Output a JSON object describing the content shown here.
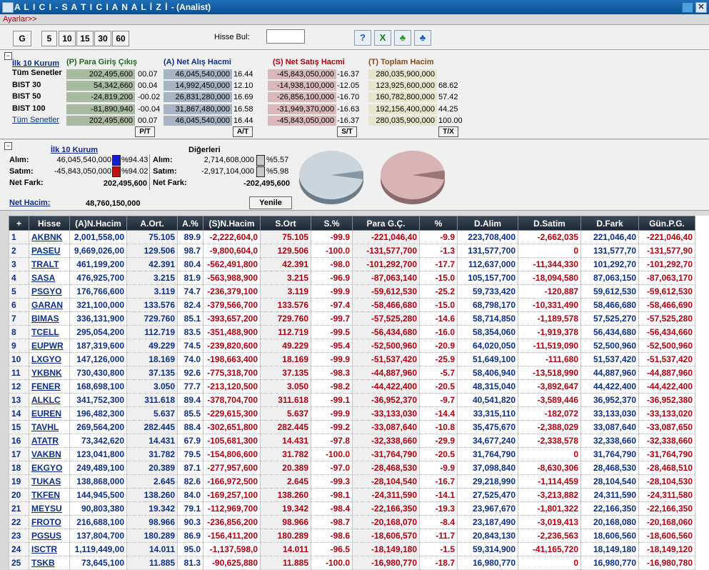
{
  "window": {
    "title": "A L I C I  -  S A T I C I   A N A L İ Z İ",
    "subtitle": "- (Analist)"
  },
  "settings_link": "Ayarlar>>",
  "toolbar": {
    "period_buttons": [
      "G",
      "5",
      "10",
      "15",
      "30",
      "60"
    ],
    "search_label": "Hisse Bul:",
    "search_value": ""
  },
  "summary": {
    "top10_link": "İlk 10 Kurum",
    "col_headers": [
      "(P) Para Giriş Çıkış",
      "(A) Net Alış Hacmi",
      "(S) Net Satış Hacmi",
      "(T) Toplam Hacim"
    ],
    "rows": [
      {
        "label": "Tüm Senetler",
        "p": "202,495,600",
        "pp": "00.07",
        "a": "46,045,540,000",
        "ap": "16.44",
        "s": "-45,843,050,000",
        "sp": "-16.37",
        "t": "280,035,900,000",
        "tp": ""
      },
      {
        "label": "BIST 30",
        "p": "54,342,660",
        "pp": "00.04",
        "a": "14,992,450,000",
        "ap": "12.10",
        "s": "-14,938,100,000",
        "sp": "-12.05",
        "t": "123,925,600,000",
        "tp": "68.62"
      },
      {
        "label": "BIST 50",
        "p": "-24,819,200",
        "pp": "-00.02",
        "a": "26,831,280,000",
        "ap": "16.69",
        "s": "-26,856,100,000",
        "sp": "-16.70",
        "t": "160,782,800,000",
        "tp": "57.42"
      },
      {
        "label": "BIST 100",
        "p": "-81,890,940",
        "pp": "-00.04",
        "a": "31,867,480,000",
        "ap": "16.58",
        "s": "-31,949,370,000",
        "sp": "-16.63",
        "t": "192,156,400,000",
        "tp": "44.25"
      },
      {
        "label": "Tüm Senetler",
        "p": "202,495,600",
        "pp": "00.07",
        "a": "46,045,540,000",
        "ap": "16.44",
        "s": "-45,843,050,000",
        "sp": "-16.37",
        "t": "280,035,900,000",
        "tp": "100.00"
      }
    ],
    "sort_buttons": [
      "P/T",
      "A/T",
      "S/T",
      "T/X"
    ]
  },
  "middle": {
    "top10_link": "İlk 10 Kurum",
    "others_title": "Diğerleri",
    "labels": {
      "alim": "Alım:",
      "satim": "Satım:",
      "net_fark": "Net Fark:",
      "net_hacim": "Net Hacim:"
    },
    "top10": {
      "alim": "46,045,540,000",
      "alim_pct": "%94.43",
      "satim": "-45,843,050,000",
      "satim_pct": "%94.02",
      "net_fark": "202,495,600"
    },
    "others": {
      "alim": "2,714,608,000",
      "alim_pct": "%5.57",
      "satim": "-2,917,104,000",
      "satim_pct": "%5.98",
      "net_fark": "-202,495,600"
    },
    "net_hacim": "48,760,150,000",
    "refresh_button": "Yenile",
    "pie_buy_share": 0.9443,
    "pie_sell_share": 0.9402
  },
  "table": {
    "headers": [
      "+",
      "Hisse",
      "(A)N.Hacim",
      "A.Ort.",
      "A.%",
      "(S)N.Hacim",
      "S.Ort",
      "S.%",
      "Para G.Ç.",
      "%",
      "D.Alim",
      "D.Satim",
      "D.Fark",
      "Gün.P.G."
    ],
    "rows": [
      [
        "1",
        "AKBNK",
        "2,001,558,00",
        "75.105",
        "89.9",
        "-2,222,604,0",
        "75.105",
        "-99.9",
        "-221,046,40",
        "-9.9",
        "223,708,400",
        "-2,662,035",
        "221,046,40",
        "-221,046,40"
      ],
      [
        "2",
        "PASEU",
        "9,669,026,00",
        "129.506",
        "98.7",
        "-9,800,604,0",
        "129.506",
        "-100.0",
        "-131,577,700",
        "-1.3",
        "131,577,700",
        "0",
        "131,577,70",
        "-131,577,90"
      ],
      [
        "3",
        "TRALT",
        "461,199,200",
        "42.391",
        "80.4",
        "-562,491,800",
        "42.391",
        "-98.0",
        "-101,292,700",
        "-17.7",
        "112,637,000",
        "-11,344,330",
        "101,292,70",
        "-101,292,70"
      ],
      [
        "4",
        "SASA",
        "476,925,700",
        "3.215",
        "81.9",
        "-563,988,900",
        "3.215",
        "-96.9",
        "-87,063,140",
        "-15.0",
        "105,157,700",
        "-18,094,580",
        "87,063,150",
        "-87,063,170"
      ],
      [
        "5",
        "PSGYO",
        "176,766,600",
        "3.119",
        "74.7",
        "-236,379,100",
        "3.119",
        "-99.9",
        "-59,612,530",
        "-25.2",
        "59,733,420",
        "-120,887",
        "59,612,530",
        "-59,612,530"
      ],
      [
        "6",
        "GARAN",
        "321,100,000",
        "133.576",
        "82.4",
        "-379,566,700",
        "133.576",
        "-97.4",
        "-58,466,680",
        "-15.0",
        "68,798,170",
        "-10,331,490",
        "58,466,680",
        "-58,466,690"
      ],
      [
        "7",
        "BIMAS",
        "336,131,900",
        "729.760",
        "85.1",
        "-393,657,200",
        "729.760",
        "-99.7",
        "-57,525,280",
        "-14.6",
        "58,714,850",
        "-1,189,578",
        "57,525,270",
        "-57,525,280"
      ],
      [
        "8",
        "TCELL",
        "295,054,200",
        "112.719",
        "83.5",
        "-351,488,900",
        "112.719",
        "-99.5",
        "-56,434,680",
        "-16.0",
        "58,354,060",
        "-1,919,378",
        "56,434,680",
        "-56,434,660"
      ],
      [
        "9",
        "EUPWR",
        "187,319,600",
        "49.229",
        "74.5",
        "-239,820,600",
        "49.229",
        "-95.4",
        "-52,500,960",
        "-20.9",
        "64,020,050",
        "-11,519,090",
        "52,500,960",
        "-52,500,960"
      ],
      [
        "10",
        "LXGYO",
        "147,126,000",
        "18.169",
        "74.0",
        "-198,663,400",
        "18.169",
        "-99.9",
        "-51,537,420",
        "-25.9",
        "51,649,100",
        "-111,680",
        "51,537,420",
        "-51,537,420"
      ],
      [
        "11",
        "YKBNK",
        "730,430,800",
        "37.135",
        "92.6",
        "-775,318,700",
        "37.135",
        "-98.3",
        "-44,887,960",
        "-5.7",
        "58,406,940",
        "-13,518,990",
        "44,887,960",
        "-44,887,960"
      ],
      [
        "12",
        "FENER",
        "168,698,100",
        "3.050",
        "77.7",
        "-213,120,500",
        "3.050",
        "-98.2",
        "-44,422,400",
        "-20.5",
        "48,315,040",
        "-3,892,647",
        "44,422,400",
        "-44,422,400"
      ],
      [
        "13",
        "ALKLC",
        "341,752,300",
        "311.618",
        "89.4",
        "-378,704,700",
        "311.618",
        "-99.1",
        "-36,952,370",
        "-9.7",
        "40,541,820",
        "-3,589,446",
        "36,952,370",
        "-36,952,380"
      ],
      [
        "14",
        "EUREN",
        "196,482,300",
        "5.637",
        "85.5",
        "-229,615,300",
        "5.637",
        "-99.9",
        "-33,133,030",
        "-14.4",
        "33,315,110",
        "-182,072",
        "33,133,030",
        "-33,133,020"
      ],
      [
        "15",
        "TAVHL",
        "269,564,200",
        "282.445",
        "88.4",
        "-302,651,800",
        "282.445",
        "-99.2",
        "-33,087,640",
        "-10.8",
        "35,475,670",
        "-2,388,029",
        "33,087,640",
        "-33,087,650"
      ],
      [
        "16",
        "ATATR",
        "73,342,620",
        "14.431",
        "67.9",
        "-105,681,300",
        "14.431",
        "-97.8",
        "-32,338,660",
        "-29.9",
        "34,677,240",
        "-2,338,578",
        "32,338,660",
        "-32,338,660"
      ],
      [
        "17",
        "VAKBN",
        "123,041,800",
        "31.782",
        "79.5",
        "-154,806,600",
        "31.782",
        "-100.0",
        "-31,764,790",
        "-20.5",
        "31,764,790",
        "0",
        "31,764,790",
        "-31,764,790"
      ],
      [
        "18",
        "EKGYO",
        "249,489,100",
        "20.389",
        "87.1",
        "-277,957,600",
        "20.389",
        "-97.0",
        "-28,468,530",
        "-9.9",
        "37,098,840",
        "-8,630,306",
        "28,468,530",
        "-28,468,510"
      ],
      [
        "19",
        "TUKAS",
        "138,868,000",
        "2.645",
        "82.6",
        "-166,972,500",
        "2.645",
        "-99.3",
        "-28,104,540",
        "-16.7",
        "29,218,990",
        "-1,114,459",
        "28,104,540",
        "-28,104,530"
      ],
      [
        "20",
        "TKFEN",
        "144,945,500",
        "138.260",
        "84.0",
        "-169,257,100",
        "138.260",
        "-98.1",
        "-24,311,590",
        "-14.1",
        "27,525,470",
        "-3,213,882",
        "24,311,590",
        "-24,311,580"
      ],
      [
        "21",
        "MEYSU",
        "90,803,380",
        "19.342",
        "79.1",
        "-112,969,700",
        "19.342",
        "-98.4",
        "-22,166,350",
        "-19.3",
        "23,967,670",
        "-1,801,322",
        "22,166,350",
        "-22,166,350"
      ],
      [
        "22",
        "FROTO",
        "216,688,100",
        "98.966",
        "90.3",
        "-236,856,200",
        "98.966",
        "-98.7",
        "-20,168,070",
        "-8.4",
        "23,187,490",
        "-3,019,413",
        "20,168,080",
        "-20,168,060"
      ],
      [
        "23",
        "PGSUS",
        "137,804,700",
        "180.289",
        "86.9",
        "-156,411,200",
        "180.289",
        "-98.6",
        "-18,606,570",
        "-11.7",
        "20,843,130",
        "-2,236,563",
        "18,606,560",
        "-18,606,560"
      ],
      [
        "24",
        "ISCTR",
        "1,119,449,00",
        "14.011",
        "95.0",
        "-1,137,598,0",
        "14.011",
        "-96.5",
        "-18,149,180",
        "-1.5",
        "59,314,900",
        "-41,165,720",
        "18,149,180",
        "-18,149,120"
      ],
      [
        "25",
        "TSKB",
        "73,645,100",
        "11.885",
        "81.3",
        "-90,625,880",
        "11.885",
        "-100.0",
        "-16,980,770",
        "-18.7",
        "16,980,770",
        "0",
        "16,980,770",
        "-16,980,780"
      ]
    ]
  },
  "colors": {
    "title_bar": "#0b4f93",
    "buy_blue": "#0b2f8a",
    "sell_red": "#b0000f",
    "pie_buy": "#cbd5dd",
    "pie_sell": "#d8b4b4"
  }
}
